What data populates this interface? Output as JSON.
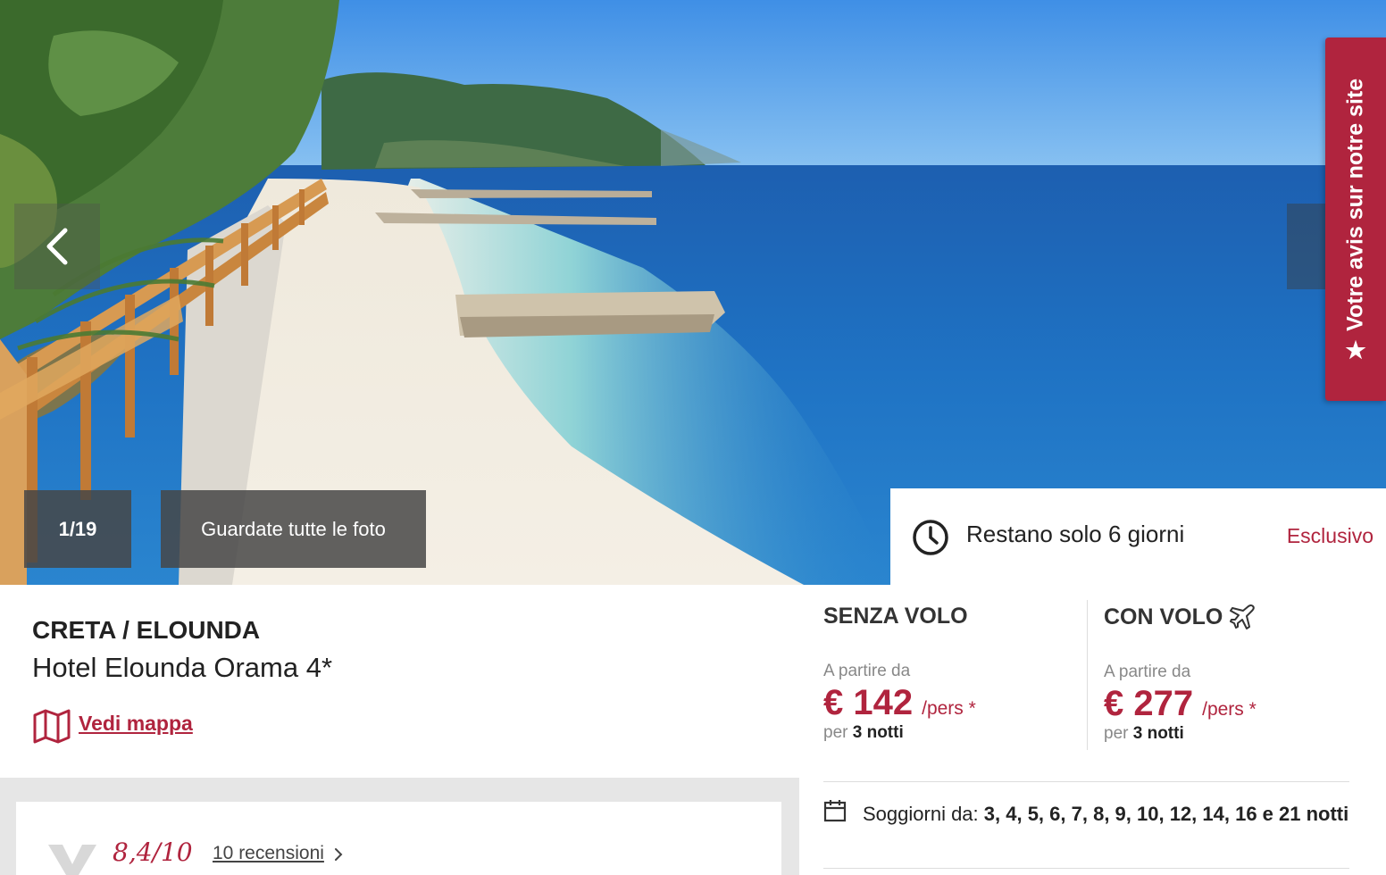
{
  "gallery": {
    "counter": "1/19",
    "all_photos_label": "Guardate tutte le foto"
  },
  "review_tab": {
    "label": "Votre avis sur notre site",
    "icon": "star-icon"
  },
  "countdown": {
    "text": "Restano solo 6 giorni",
    "badge": "Esclusivo",
    "icon": "clock-icon"
  },
  "hotel": {
    "location": "CRETA / ELOUNDA",
    "name": "Hotel Elounda Orama 4*",
    "map_link": "Vedi mappa"
  },
  "rating": {
    "score": "8,4/10",
    "reviews_link": "10 recensioni"
  },
  "pricing": {
    "without_flight": {
      "title": "SENZA VOLO",
      "from_label": "A partire da",
      "price": "€ 142",
      "unit": "/pers *",
      "per_label": "per",
      "nights": "3 notti"
    },
    "with_flight": {
      "title": "CON VOLO",
      "from_label": "A partire da",
      "price": "€ 277",
      "unit": "/pers *",
      "per_label": "per",
      "nights": "3 notti"
    }
  },
  "stays": {
    "label": "Soggiorni da:",
    "values": "3, 4, 5, 6, 7, 8, 9, 10, 12, 14, 16 e 21 notti"
  },
  "colors": {
    "accent": "#b0243e",
    "overlay": "#464646",
    "grey_band": "#e6e6e6"
  }
}
